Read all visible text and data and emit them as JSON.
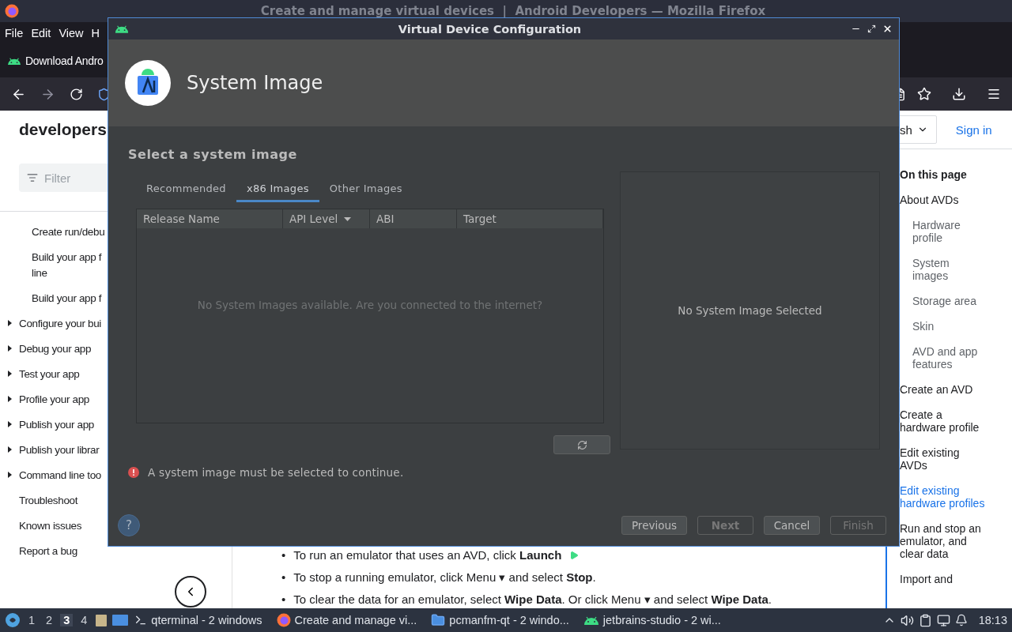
{
  "browser": {
    "title": "Create and manage virtual devices  |  Android Developers — Mozilla Firefox",
    "menu": [
      "File",
      "Edit",
      "View",
      "H"
    ],
    "tab": {
      "title": "Download Andro"
    },
    "page": {
      "logo": "developers",
      "language": "sh",
      "sign_in": "Sign in",
      "filter": {
        "placeholder": "Filter"
      },
      "nav": [
        {
          "label": "Create run/debu",
          "kind": "subitem"
        },
        {
          "label": "Build your app f\nline",
          "kind": "subitem"
        },
        {
          "label": "Build your app f",
          "kind": "subitem"
        },
        {
          "label": "Configure your bui",
          "kind": "expandable"
        },
        {
          "label": "Debug your app",
          "kind": "expandable"
        },
        {
          "label": "Test your app",
          "kind": "expandable"
        },
        {
          "label": "Profile your app",
          "kind": "expandable"
        },
        {
          "label": "Publish your app",
          "kind": "expandable"
        },
        {
          "label": "Publish your librar",
          "kind": "expandable"
        },
        {
          "label": "Command line too",
          "kind": "expandable"
        },
        {
          "label": "Troubleshoot",
          "kind": "item"
        },
        {
          "label": "Known issues",
          "kind": "item"
        },
        {
          "label": "Report a bug",
          "kind": "item"
        }
      ],
      "bullets": [
        {
          "marker": "•",
          "text": "To run an emulator that uses an AVD, click **Launch**"
        },
        {
          "marker": "•",
          "text": "To stop a running emulator, click Menu ▾ and select **Stop**."
        },
        {
          "marker": "•",
          "text": "To clear the data for an emulator, select **Wipe Data**. Or click Menu ▾ and select **Wipe Data**."
        }
      ],
      "toc": {
        "heading": "On this page",
        "items": [
          {
            "label": "About AVDs",
            "kind": "item",
            "selected": false
          },
          {
            "label": "Hardware profile",
            "kind": "subitem",
            "selected": false
          },
          {
            "label": "System images",
            "kind": "subitem",
            "selected": false
          },
          {
            "label": "Storage area",
            "kind": "subitem",
            "selected": false
          },
          {
            "label": "Skin",
            "kind": "subitem",
            "selected": false
          },
          {
            "label": "AVD and app features",
            "kind": "subitem",
            "selected": false
          },
          {
            "label": "Create an AVD",
            "kind": "item",
            "selected": false
          },
          {
            "label": "Create a hardware profile",
            "kind": "item",
            "selected": false
          },
          {
            "label": "Edit existing AVDs",
            "kind": "item",
            "selected": false
          },
          {
            "label": "Edit existing hardware profiles",
            "kind": "item",
            "selected": true
          },
          {
            "label": "Run and stop an emulator, and clear data",
            "kind": "item",
            "selected": false
          },
          {
            "label": "Import and",
            "kind": "item",
            "selected": false
          }
        ]
      }
    }
  },
  "dialog": {
    "title": "Virtual Device Configuration",
    "heading": "System Image",
    "section": "Select a system image",
    "tabs": [
      {
        "label": "Recommended",
        "selected": false
      },
      {
        "label": "x86 Images",
        "selected": true
      },
      {
        "label": "Other Images",
        "selected": false
      }
    ],
    "columns": [
      {
        "label": "Release Name",
        "sorted": false
      },
      {
        "label": "API Level",
        "sorted": true
      },
      {
        "label": "ABI",
        "sorted": false
      },
      {
        "label": "Target",
        "sorted": false
      }
    ],
    "empty_message": "No System Images available. Are you connected to the internet?",
    "detail_message": "No System Image Selected",
    "error": "A system image must be selected to continue.",
    "help": "?",
    "buttons": [
      {
        "label": "Previous",
        "disabled": false
      },
      {
        "label": "Next",
        "disabled": true
      },
      {
        "label": "Cancel",
        "disabled": false
      },
      {
        "label": "Finish",
        "disabled": true
      }
    ]
  },
  "taskbar": {
    "desktops": [
      {
        "label": "1",
        "selected": false
      },
      {
        "label": "2",
        "selected": false
      },
      {
        "label": "3",
        "selected": true
      },
      {
        "label": "4",
        "selected": false
      }
    ],
    "tasks": [
      {
        "label": "qterminal - 2 windows",
        "kind": "terminal"
      },
      {
        "label": "Create and manage vi...",
        "kind": "browser"
      },
      {
        "label": "pcmanfm-qt - 2 windo...",
        "kind": "folder"
      },
      {
        "label": "jetbrains-studio - 2 wi...",
        "kind": "android"
      }
    ],
    "clock": "18:13"
  }
}
